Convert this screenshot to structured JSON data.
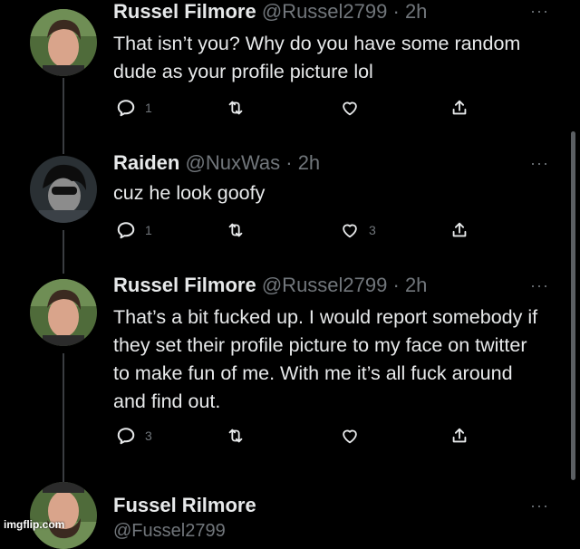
{
  "tweets": [
    {
      "name": "Russel Filmore",
      "handle": "@Russel2799",
      "time": "· 2h",
      "text": "That isn’t you? Why do you have some random dude as your profile picture lol",
      "replies": "1",
      "retweets": "",
      "likes": "",
      "more": "···"
    },
    {
      "name": "Raiden",
      "handle": "@NuxWas",
      "time": "· 2h",
      "text": "cuz he look goofy",
      "replies": "1",
      "retweets": "",
      "likes": "3",
      "more": "···"
    },
    {
      "name": "Russel Filmore",
      "handle": "@Russel2799",
      "time": "· 2h",
      "text": "That’s a bit fucked up. I would report somebody if they set their profile picture to my face on twitter to make fun of me. With me it’s all fuck around and find out.",
      "replies": "3",
      "retweets": "",
      "likes": "",
      "more": "···"
    },
    {
      "name": "Fussel Rilmore",
      "handle": "@Fussel2799",
      "more": "···"
    }
  ],
  "icons": {
    "reply": "reply-icon",
    "retweet": "retweet-icon",
    "like": "heart-icon",
    "share": "share-icon"
  },
  "watermark": "imgflip.com",
  "colors": {
    "background": "#000000",
    "text": "#e7e9ea",
    "muted": "#71767b"
  }
}
